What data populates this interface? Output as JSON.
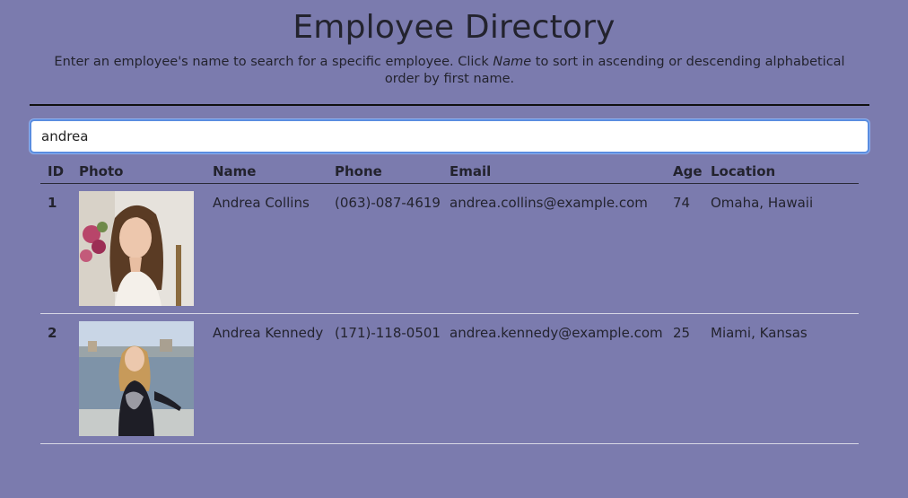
{
  "header": {
    "title": "Employee Directory",
    "subtitle_before": "Enter an employee's name to search for a specific employee. Click ",
    "subtitle_em": "Name",
    "subtitle_after": " to sort in ascending or descending alphabetical order by first name."
  },
  "search": {
    "value": "andrea",
    "placeholder": ""
  },
  "table": {
    "columns": [
      "ID",
      "Photo",
      "Name",
      "Phone",
      "Email",
      "Age",
      "Location"
    ],
    "rows": [
      {
        "id": "1",
        "photo": "employee-photo",
        "name": "Andrea Collins",
        "phone": "(063)-087-4619",
        "email": "andrea.collins@example.com",
        "age": "74",
        "location": "Omaha, Hawaii"
      },
      {
        "id": "2",
        "photo": "employee-photo",
        "name": "Andrea Kennedy",
        "phone": "(171)-118-0501",
        "email": "andrea.kennedy@example.com",
        "age": "25",
        "location": "Miami, Kansas"
      }
    ]
  },
  "colors": {
    "background": "#7b7bae",
    "text": "#23232e",
    "input_focus": "#5a8de0"
  }
}
